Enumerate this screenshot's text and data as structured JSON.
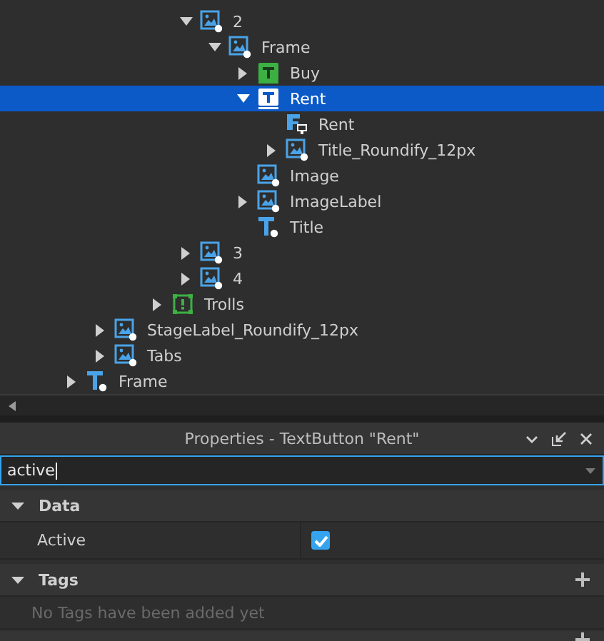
{
  "explorer": {
    "items": [
      {
        "children": [
          {
            "children": [
              {
                "children": [
                  {
                    "children": [
                      {
                        "label": "2",
                        "kind": "image",
                        "expanded": true,
                        "selected": false,
                        "children": [
                          {
                            "label": "Frame",
                            "kind": "image",
                            "expanded": true,
                            "selected": false,
                            "children": [
                              {
                                "label": "Buy",
                                "kind": "textbutton-green",
                                "expanded": false,
                                "selected": false
                              },
                              {
                                "label": "Rent",
                                "kind": "textbutton",
                                "expanded": true,
                                "selected": true,
                                "children": [
                                  {
                                    "label": "Rent",
                                    "kind": "script",
                                    "selected": false
                                  },
                                  {
                                    "label": "Title_Roundify_12px",
                                    "kind": "image",
                                    "expanded": false,
                                    "selected": false
                                  }
                                ]
                              },
                              {
                                "label": "Image",
                                "kind": "image",
                                "selected": false
                              },
                              {
                                "label": "ImageLabel",
                                "kind": "image",
                                "expanded": false,
                                "selected": false
                              },
                              {
                                "label": "Title",
                                "kind": "textlabel",
                                "selected": false
                              }
                            ]
                          }
                        ]
                      },
                      {
                        "label": "3",
                        "kind": "image",
                        "expanded": false,
                        "selected": false
                      },
                      {
                        "label": "4",
                        "kind": "image",
                        "expanded": false,
                        "selected": false
                      }
                    ]
                  },
                  {
                    "label": "Trolls",
                    "kind": "frame-green",
                    "expanded": false,
                    "selected": false
                  }
                ]
              }
            ]
          },
          {
            "label": "StageLabel_Roundify_12px",
            "kind": "image",
            "expanded": false,
            "selected": false
          },
          {
            "label": "Tabs",
            "kind": "image",
            "expanded": false,
            "selected": false
          }
        ]
      },
      {
        "label": "Frame",
        "kind": "textlabel",
        "expanded": false,
        "selected": false
      }
    ]
  },
  "properties": {
    "title": "Properties - TextButton \"Rent\"",
    "filter": "active",
    "sections": [
      {
        "title": "Data",
        "expanded": true,
        "rows": [
          {
            "name": "Active",
            "checked": true
          }
        ]
      },
      {
        "title": "Tags",
        "expanded": true,
        "addable": true,
        "empty_text": "No Tags have been added yet"
      }
    ]
  }
}
